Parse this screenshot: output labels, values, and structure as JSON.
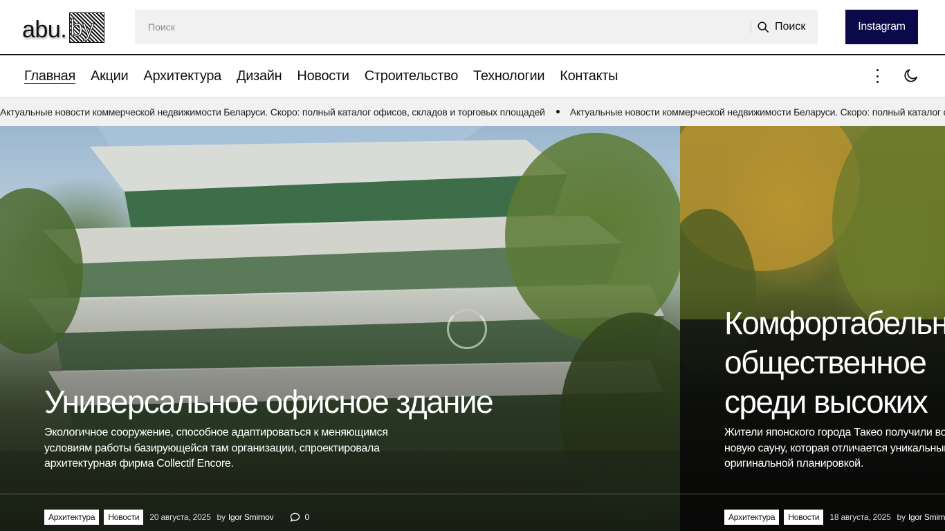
{
  "header": {
    "logo_text": "abu.",
    "logo_box_text": "by",
    "search_placeholder": "Поиск",
    "search_button": "Поиск",
    "instagram_label": "Instagram"
  },
  "nav": {
    "items": [
      {
        "label": "Главная",
        "active": true
      },
      {
        "label": "Акции"
      },
      {
        "label": "Архитектура"
      },
      {
        "label": "Дизайн"
      },
      {
        "label": "Новости"
      },
      {
        "label": "Строительство"
      },
      {
        "label": "Технологии"
      },
      {
        "label": "Контакты"
      }
    ]
  },
  "ticker": {
    "items": [
      "Актуальные новости коммерческой недвижимости Беларуси. Скоро: полный каталог офисов, складов и торговых площадей",
      "Актуальные новости коммерческой недвижимости Беларуси. Скоро: полный каталог офисов, складов и торговых площадей"
    ]
  },
  "slides": [
    {
      "title": "Универсальное офисное здание",
      "description": "Экологичное сооружение, способное адаптироваться к меняющимся условиям работы базирующейся там организации, спроектировала архитектурная фирма Collectif Encore.",
      "tags": [
        "Архитектура",
        "Новости"
      ],
      "date": "20 августа, 2025",
      "by": "by",
      "author": "Igor Smirnov",
      "comments": "0"
    },
    {
      "title_lines": [
        "Комфортабельное",
        "общественное",
        "среди высоких"
      ],
      "description": "Жители японского города Такео получили возможность посетить новую сауну, которая отличается уникальным оформлением и оригинальной планировкой.",
      "tags": [
        "Архитектура",
        "Новости"
      ],
      "date": "18 августа, 2025",
      "by": "by",
      "author": "Igor Smirnov"
    }
  ]
}
